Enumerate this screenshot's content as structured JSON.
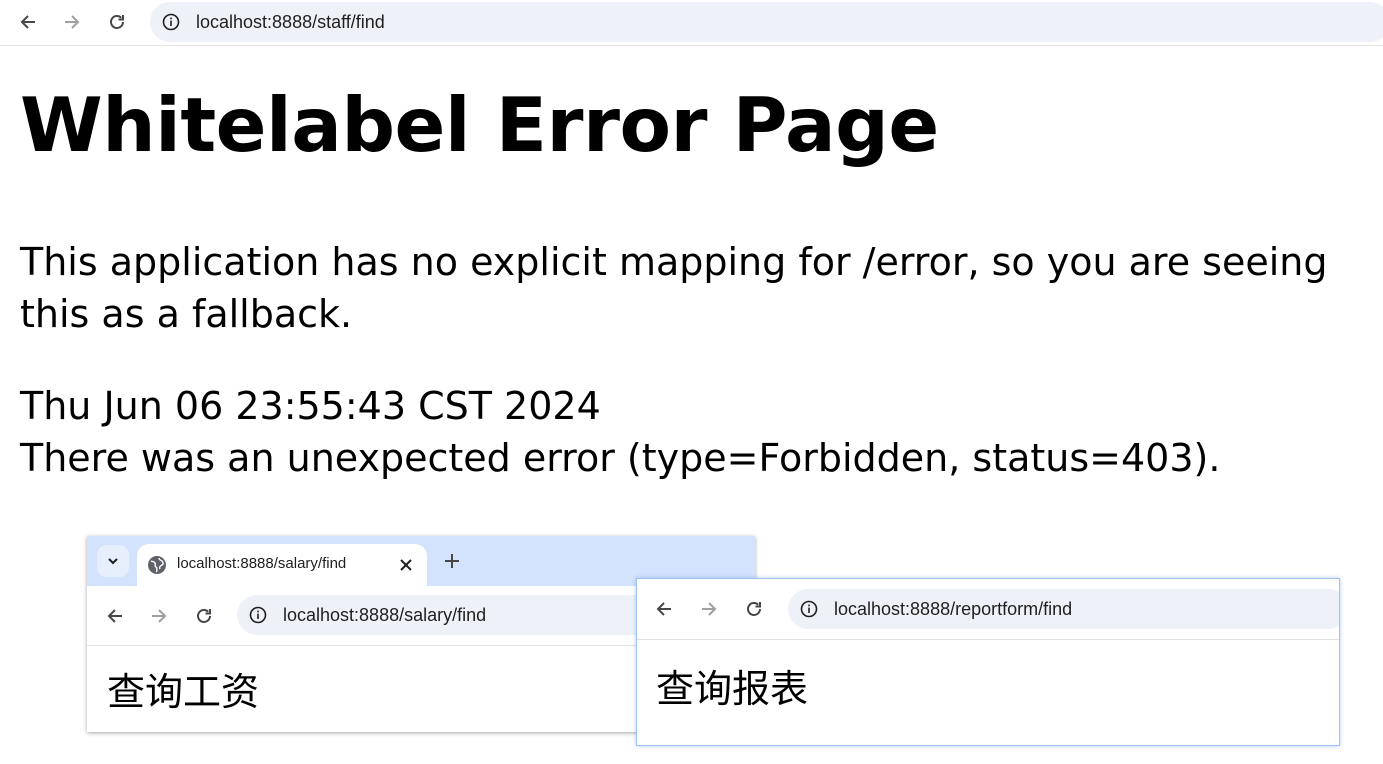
{
  "browser": {
    "url": "localhost:8888/staff/find",
    "icons": {
      "back": "arrow-left-icon",
      "forward": "arrow-right-icon",
      "reload": "reload-icon",
      "site_info": "info-icon"
    }
  },
  "error_page": {
    "title": "Whitelabel Error Page",
    "message": "This application has no explicit mapping for /error, so you are seeing this as a fallback.",
    "timestamp": "Thu Jun 06 23:55:43 CST 2024",
    "status_line": "There was an unexpected error (type=Forbidden, status=403)."
  },
  "inset_window_salary": {
    "tab_title": "localhost:8888/salary/find",
    "url": "localhost:8888/salary/find",
    "heading": "查询工资",
    "icons": {
      "tab_search": "chevron-down-icon",
      "favicon": "globe-icon",
      "close": "close-icon",
      "new_tab": "plus-icon"
    }
  },
  "inset_window_report": {
    "url": "localhost:8888/reportform/find",
    "heading": "查询报表"
  },
  "colors": {
    "omnibox_bg": "#eef1f8",
    "tabstrip_bg": "#d3e3fd",
    "focus_border": "#9fc3f5",
    "text": "#000000"
  }
}
